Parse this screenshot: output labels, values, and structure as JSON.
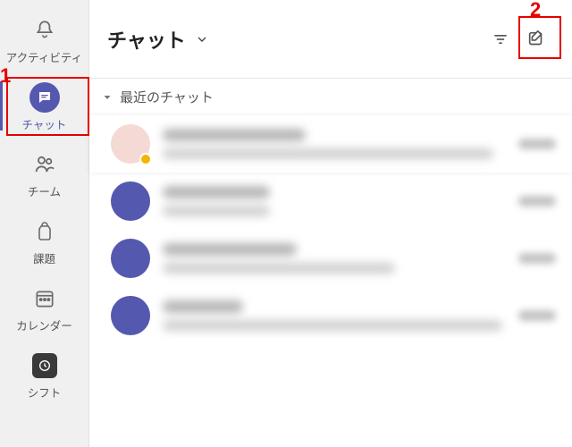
{
  "rail": {
    "items": [
      {
        "key": "activity",
        "label": "アクティビティ"
      },
      {
        "key": "chat",
        "label": "チャット",
        "active": true
      },
      {
        "key": "teams",
        "label": "チーム"
      },
      {
        "key": "assign",
        "label": "課題"
      },
      {
        "key": "calendar",
        "label": "カレンダー"
      },
      {
        "key": "shifts",
        "label": "シフト"
      }
    ]
  },
  "header": {
    "title": "チャット",
    "dropdown_icon": "chevron-down",
    "filter_icon": "filter",
    "compose_icon": "compose-new"
  },
  "section": {
    "label": "最近のチャット",
    "collapse_icon": "caret-down"
  },
  "chats": [
    {
      "avatar_kind": "guest",
      "presence": "away",
      "title_w": 160,
      "preview_w": 370,
      "selected": true
    },
    {
      "avatar_kind": "default",
      "title_w": 120,
      "preview_w": 120
    },
    {
      "avatar_kind": "default",
      "title_w": 150,
      "preview_w": 260
    },
    {
      "avatar_kind": "default",
      "title_w": 90,
      "preview_w": 380
    }
  ],
  "annotations": {
    "1": "chat-nav-item",
    "2": "compose-button"
  }
}
